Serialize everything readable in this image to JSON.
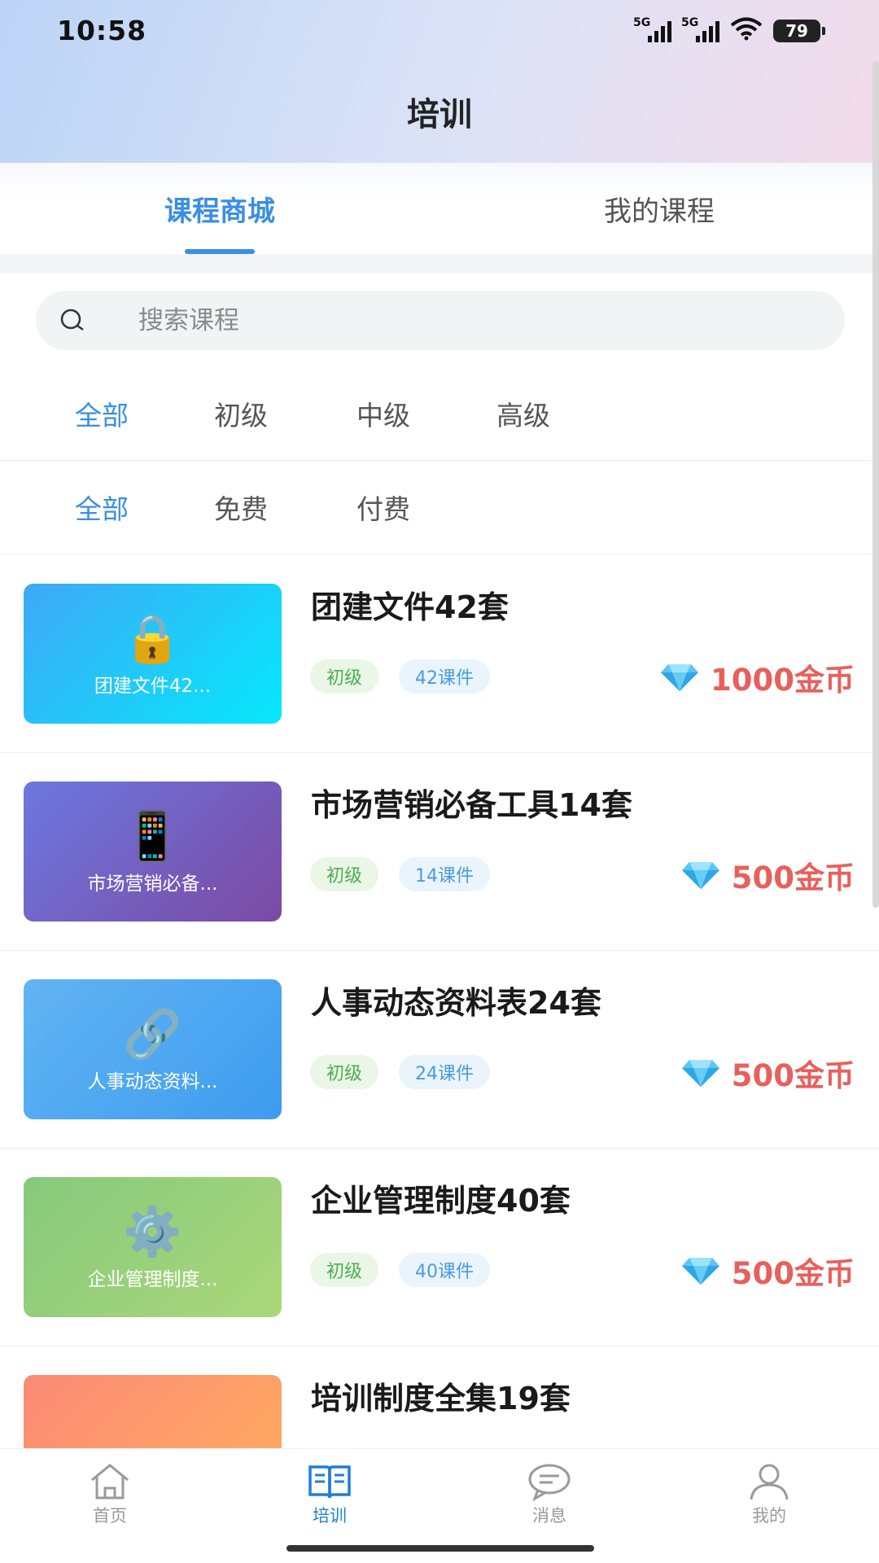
{
  "status_bar": {
    "time": "10:58",
    "signal1_label": "5G",
    "signal2_label": "5G",
    "battery": "79"
  },
  "header": {
    "title": "培训"
  },
  "tabs": [
    {
      "label": "课程商城",
      "active": true
    },
    {
      "label": "我的课程",
      "active": false
    }
  ],
  "search": {
    "placeholder": "搜索课程",
    "value": ""
  },
  "level_filters": [
    {
      "label": "全部",
      "active": true
    },
    {
      "label": "初级",
      "active": false
    },
    {
      "label": "中级",
      "active": false
    },
    {
      "label": "高级",
      "active": false
    }
  ],
  "price_filters": [
    {
      "label": "全部",
      "active": true
    },
    {
      "label": "免费",
      "active": false
    },
    {
      "label": "付费",
      "active": false
    }
  ],
  "courses": [
    {
      "title": "团建文件42套",
      "thumb_text": "团建文件42...",
      "icon": "lock-icon",
      "level": "初级",
      "count": "42课件",
      "price": "1000金币"
    },
    {
      "title": "市场营销必备工具14套",
      "thumb_text": "市场营销必备...",
      "icon": "phone-icon",
      "level": "初级",
      "count": "14课件",
      "price": "500金币"
    },
    {
      "title": "人事动态资料表24套",
      "thumb_text": "人事动态资料...",
      "icon": "link-icon",
      "level": "初级",
      "count": "24课件",
      "price": "500金币"
    },
    {
      "title": "企业管理制度40套",
      "thumb_text": "企业管理制度...",
      "icon": "gear-icon",
      "level": "初级",
      "count": "40课件",
      "price": "500金币"
    },
    {
      "title": "培训制度全集19套",
      "thumb_text": "",
      "icon": "cloud-icon",
      "level": "",
      "count": "",
      "price": ""
    }
  ],
  "bottom_nav": [
    {
      "label": "首页",
      "icon": "home-icon",
      "active": false
    },
    {
      "label": "培训",
      "icon": "book-icon",
      "active": true
    },
    {
      "label": "消息",
      "icon": "chat-icon",
      "active": false
    },
    {
      "label": "我的",
      "icon": "user-icon",
      "active": false
    }
  ],
  "colors": {
    "accent": "#3a8ee6",
    "price": "#e8605c",
    "tag_level": "#4caf50",
    "tag_count": "#4a9be0"
  }
}
